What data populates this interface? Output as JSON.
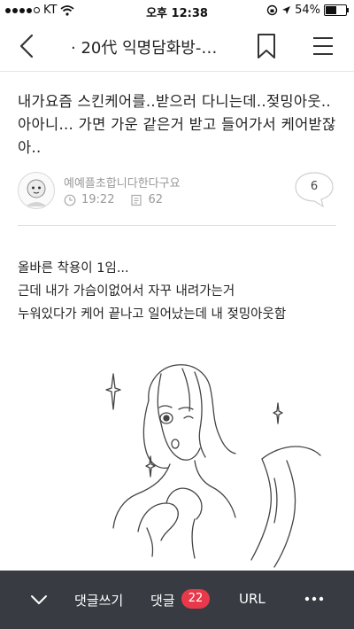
{
  "status_bar": {
    "carrier": "KT",
    "time": "오후 12:38",
    "battery": "54%",
    "battery_level": 0.54
  },
  "nav": {
    "title": "· 20代 익명담화방-…"
  },
  "post": {
    "title": "내가요즘 스킨케어를..받으러 다니는데..젖밍아웃..아아니... 가면 가운 같은거 받고 들어가서 케어받잖아..",
    "author": "예예플초합니다한다구요",
    "time": "19:22",
    "views": "62",
    "comment_count": "6"
  },
  "content": {
    "lines": [
      "올바른 착용이 1임...",
      "근데 내가 가슴이없어서 자꾸 내려가는거",
      "누워있다가 케어 끝나고 일어났는데 내 젖밍아웃함"
    ]
  },
  "bottom_bar": {
    "write_comment": "댓글쓰기",
    "comments_label": "댓글",
    "comments_badge": "22",
    "url_label": "URL"
  },
  "colors": {
    "bottom_bar_bg": "#383c42",
    "badge": "#e8394a"
  }
}
